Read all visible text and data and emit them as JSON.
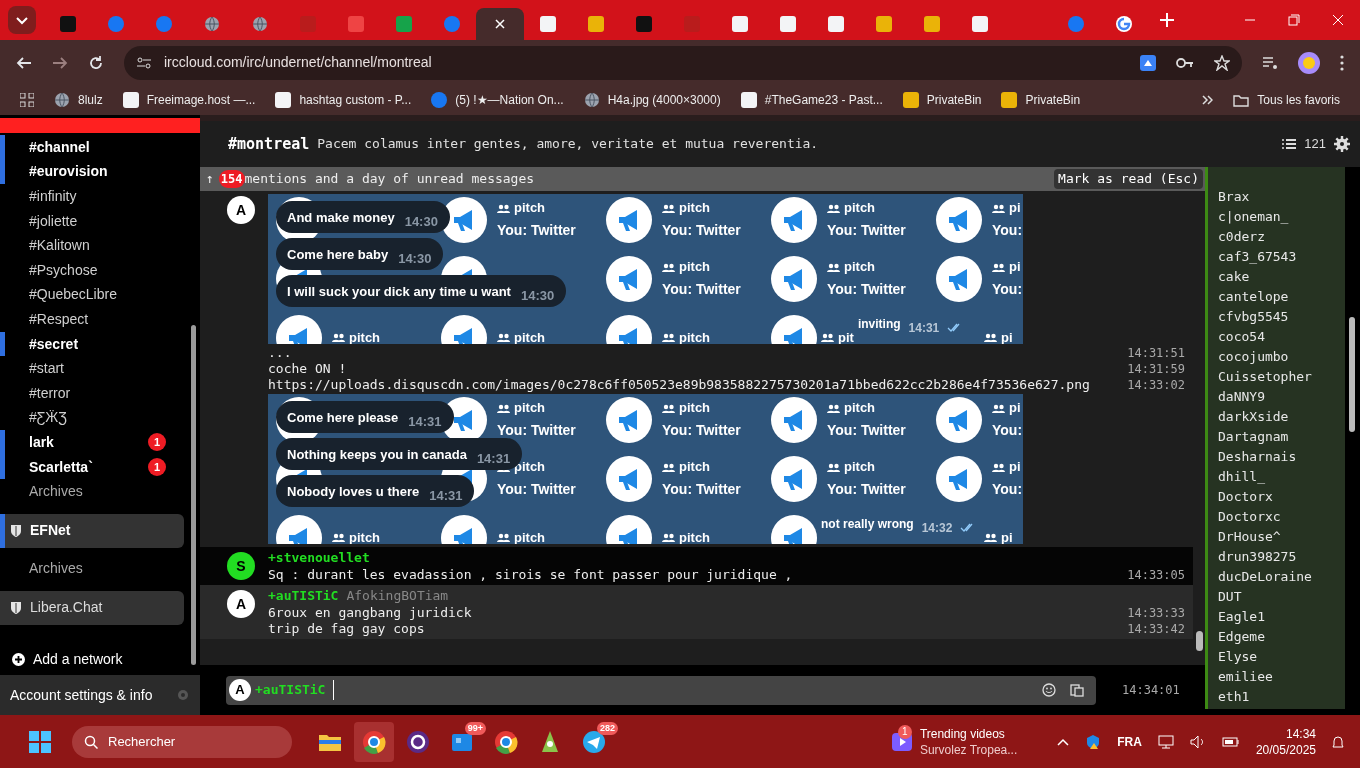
{
  "browser": {
    "tabs": [
      {
        "kind": "dark",
        "selected": false
      },
      {
        "kind": "blue",
        "selected": false
      },
      {
        "kind": "blue",
        "selected": false
      },
      {
        "kind": "globe",
        "selected": false
      },
      {
        "kind": "globe",
        "selected": false
      },
      {
        "kind": "red",
        "selected": false
      },
      {
        "kind": "orange",
        "selected": false
      },
      {
        "kind": "green",
        "selected": false
      },
      {
        "kind": "blue",
        "selected": false
      },
      {
        "kind": "blank",
        "selected": true
      },
      {
        "kind": "white",
        "selected": false
      },
      {
        "kind": "gold",
        "selected": false
      },
      {
        "kind": "dark",
        "selected": false
      },
      {
        "kind": "red",
        "selected": false
      },
      {
        "kind": "white",
        "selected": false
      },
      {
        "kind": "white",
        "selected": false
      },
      {
        "kind": "white",
        "selected": false
      },
      {
        "kind": "gold",
        "selected": false
      },
      {
        "kind": "gold",
        "selected": false
      },
      {
        "kind": "white",
        "selected": false
      },
      {
        "kind": "blank",
        "selected": false
      },
      {
        "kind": "blue",
        "selected": false
      },
      {
        "kind": "google",
        "selected": false
      }
    ],
    "address": "irccloud.com/irc/undernet/channel/montreal",
    "bookmarks": [
      {
        "label": "8lulz",
        "kind": "globe"
      },
      {
        "label": "Freeimage.host —...",
        "kind": "white"
      },
      {
        "label": "hashtag custom - P...",
        "kind": "white"
      },
      {
        "label": "(5) !★—Nation On...",
        "kind": "blue"
      },
      {
        "label": "H4a.jpg (4000×3000)",
        "kind": "globe"
      },
      {
        "label": "#TheGame23 - Past...",
        "kind": "white"
      },
      {
        "label": "PrivateBin",
        "kind": "gold"
      },
      {
        "label": "PrivateBin",
        "kind": "gold"
      }
    ],
    "all_bookmarks": "Tous les favoris"
  },
  "sidebar": {
    "items": [
      {
        "label": "#channel",
        "unread": true
      },
      {
        "label": "#eurovision",
        "unread": true
      },
      {
        "label": "#infinity",
        "unread": false
      },
      {
        "label": "#joliette",
        "unread": false
      },
      {
        "label": "#Kalitown",
        "unread": false
      },
      {
        "label": "#Psychose",
        "unread": false
      },
      {
        "label": "#QuebecLibre",
        "unread": false
      },
      {
        "label": "#Respect",
        "unread": false
      },
      {
        "label": "#secret",
        "unread": true
      },
      {
        "label": "#start",
        "unread": false
      },
      {
        "label": "#terror",
        "unread": false
      },
      {
        "label": "#ƸӜƷ",
        "unread": false
      },
      {
        "label": "lark",
        "unread": true,
        "badge": "1"
      },
      {
        "label": "Scarletta`",
        "unread": true,
        "badge": "1"
      },
      {
        "label": "Archives",
        "unread": false,
        "kind": "archive"
      }
    ],
    "networks": [
      {
        "name": "EFNet",
        "unread": true,
        "items": [
          {
            "label": "Archives",
            "unread": false,
            "kind": "archive"
          }
        ]
      },
      {
        "name": "Libera.Chat",
        "unread": false
      }
    ],
    "add_network": "Add a network",
    "account": "Account settings & info"
  },
  "channel": {
    "name": "#montreal",
    "topic": "Pacem colamus inter gentes, amore, veritate et mutua reverentia.",
    "user_count": "121"
  },
  "unread_bar": {
    "arrow": "↑",
    "count": "154",
    "text": "mentions and a day of unread messages",
    "button": "Mark as read (Esc)"
  },
  "messages": [
    {
      "avatar": "A",
      "color": "#ffffff",
      "entries": [
        {
          "kind": "image",
          "bubbles": [
            {
              "text": "And make money",
              "time": "14:30"
            },
            {
              "text": "Come here baby",
              "time": "14:30"
            },
            {
              "text": "I will suck your dick any time u want",
              "time": "14:30"
            }
          ],
          "rows": [
            [
              {},
              {
                "name": "pitch",
                "preview": "You: Twitter"
              },
              {
                "name": "pitch",
                "preview": "You: Twitter"
              },
              {
                "name": "pitch",
                "preview": "You: Twitter"
              },
              {
                "name": "pi",
                "preview": "You:"
              }
            ],
            [
              {},
              {},
              {
                "name": "pitch",
                "preview": "You: Twitter"
              },
              {
                "name": "pitch",
                "preview": "You: Twitter"
              },
              {
                "name": "pi",
                "preview": "You:"
              }
            ],
            [
              {
                "name": "pitch"
              },
              {
                "name": "pitch"
              },
              {
                "name": "pitch"
              },
              {
                "name": "pit",
                "overlay": {
                  "text": "inviting",
                  "time": "14:31"
                }
              },
              {
                "name": "pi"
              }
            ]
          ]
        },
        {
          "kind": "line",
          "text": "...",
          "time": "14:31:51"
        },
        {
          "kind": "line",
          "text": "coche ON !",
          "time": "14:31:59"
        },
        {
          "kind": "line",
          "text": "https://uploads.disquscdn.com/images/0c278c6ff050523e89b9835882275730201a71bbed622cc2b286e4f73536e627.png",
          "time": "14:33:02"
        },
        {
          "kind": "image",
          "bubbles": [
            {
              "text": "Come here please",
              "time": "14:31"
            },
            {
              "text": "Nothing keeps you in canada",
              "time": "14:31"
            },
            {
              "text": "Nobody loves u there",
              "time": "14:31"
            }
          ],
          "rows": [
            [
              {},
              {
                "name": "pitch",
                "preview": "You: Twitter"
              },
              {
                "name": "pitch",
                "preview": "You: Twitter"
              },
              {
                "name": "pitch",
                "preview": "You: Twitter"
              },
              {
                "name": "pi",
                "preview": "You:"
              }
            ],
            [
              {},
              {
                "name": "pitch",
                "preview": "You: Twitter"
              },
              {
                "name": "pitch",
                "preview": "You: Twitter"
              },
              {
                "name": "pitch",
                "preview": "You: Twitter"
              },
              {
                "name": "pi",
                "preview": "You:"
              }
            ],
            [
              {
                "name": "pitch"
              },
              {
                "name": "pitch"
              },
              {
                "name": "pitch"
              },
              {
                "overlay": {
                  "text": "not really wrong",
                  "time": "14:32"
                }
              },
              {
                "name": "pi"
              }
            ]
          ]
        }
      ]
    },
    {
      "avatar": "S",
      "color": "#22dd22",
      "nick": "stvenouellet",
      "mode": "+",
      "entries": [
        {
          "kind": "line",
          "text": "Sq : durant les evadassion , sirois se font passer pour juridique ,",
          "time": "14:33:05"
        }
      ]
    },
    {
      "avatar": "A",
      "color": "#ffffff",
      "nick": "auTISTiC",
      "mode": "+",
      "realname": "AfokingBOTiam",
      "entries": [
        {
          "kind": "line",
          "text": "6roux en gangbang juridick",
          "time": "14:33:33"
        },
        {
          "kind": "line",
          "text": "trip de fag gay cops",
          "time": "14:33:42"
        }
      ]
    }
  ],
  "input": {
    "avatar": "A",
    "mode": "+",
    "nick": "auTISTiC",
    "time": "14:34:01"
  },
  "users": [
    "Brax",
    "c|oneman_",
    "c0derz",
    "caf3_67543",
    "cake",
    "cantelope",
    "cfvbg5545",
    "coco54",
    "cocojumbo",
    "Cuissetopher",
    "daNNY9",
    "darkXside",
    "Dartagnam",
    "Desharnais",
    "dhill_",
    "Doctorx",
    "Doctorxc",
    "DrHouse^",
    "drun398275",
    "ducDeLoraine",
    "DUT",
    "Eagle1",
    "Edgeme",
    "Elyse",
    "emiliee",
    "eth1"
  ],
  "taskbar": {
    "search": "Rechercher",
    "apps": [
      {
        "kind": "windows"
      },
      {
        "kind": "files"
      },
      {
        "kind": "chrome",
        "selected": true
      },
      {
        "kind": "sync",
        "selected": false
      },
      {
        "kind": "store",
        "badge": "99+",
        "selected": false
      },
      {
        "kind": "chrome",
        "selected": false
      },
      {
        "kind": "cone",
        "selected": false
      },
      {
        "kind": "telegram",
        "badge": "282",
        "selected": false
      }
    ],
    "widget": {
      "badge": "1",
      "title": "Trending videos",
      "subtitle": "Survolez Tropea..."
    },
    "language": "FRA",
    "time": "14:34",
    "date": "20/05/2025"
  }
}
